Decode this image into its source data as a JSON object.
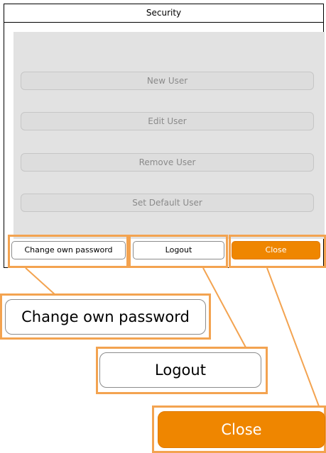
{
  "dialog": {
    "title": "Security"
  },
  "panel": {
    "buttons": [
      {
        "label": "New User"
      },
      {
        "label": "Edit User"
      },
      {
        "label": "Remove User"
      },
      {
        "label": "Set Default User"
      }
    ]
  },
  "footer": {
    "change_password_label": "Change own password",
    "logout_label": "Logout",
    "close_label": "Close"
  },
  "zoom": {
    "change_password_label": "Change own password",
    "logout_label": "Logout",
    "close_label": "Close"
  },
  "colors": {
    "accent_orange": "#ef8600",
    "highlight_orange": "#f3a350",
    "disabled_panel": "#e2e2e2"
  }
}
